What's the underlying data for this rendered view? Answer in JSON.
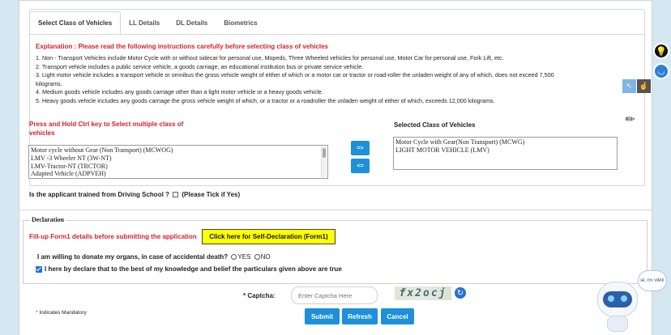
{
  "tabs": [
    {
      "label": "Select Class of Vehicles",
      "active": true
    },
    {
      "label": "LL Details"
    },
    {
      "label": "DL Details"
    },
    {
      "label": "Biometrics"
    }
  ],
  "explanation_title": "Explanation : Please read the following instructions carefully before selecting class of vehicles",
  "instructions": [
    "1. Non - Transport Vehicles include Motor Cycle with or without sidecar for personal use, Mopeds, Three Wheeled vehicles for personal use, Motor Car for personal use, Fork Lift, etc.",
    "2. Transport vehicle includes a public service vehicle, a goods carriage, an educational institution bus or private service vehicle.",
    "3. Light motor vehicle includes a transport vehicle or omnibus the gross vehicle weight of either of which or a motor car or tractor or road-roller the unladen weight of any of which, does not exceed 7,500",
    "kilograms.",
    "4. Medium goods vehicle includes any goods carriage other than a light motor vehicle or a heavy goods vehicle.",
    "5. Heavy goods vehicle includes any goods carriage the gross vehicle weight of which, or a tractor or a roadroller the unladen weight of either of which, exceeds 12,000 kilograms."
  ],
  "press_hold": "Press and Hold Ctrl key to Select multiple class of vehicles",
  "available_classes": [
    "Motor cycle without Gear (Non Transport) (MCWOG)",
    "LMV -3 Wheeler NT (3W-NT)",
    "LMV-Tractor-NT (TRCTOR)",
    "Adapted Vehicle (ADPVEH)"
  ],
  "buttons": {
    "add": "=>",
    "remove": "<=",
    "self_declaration": "Click here for Self-Declaration (Form1)",
    "submit": "Submit",
    "refresh": "Refresh",
    "cancel": "Cancel"
  },
  "selected_title": "Selected Class of Vehicles",
  "selected_classes": [
    "Motor Cycle with Gear(Non Transport) (MCWG)",
    "LIGHT MOTOR VEHICLE (LMV)"
  ],
  "trained_question": "Is the applicant trained from Driving School ?",
  "trained_hint": "(Please Tick if Yes)",
  "declaration": {
    "legend": "Declaration",
    "fillup_text": "Fill-up Form1 details before submitting the application",
    "organ_question": "I am willing to donate my organs, in case of accidental death?",
    "yes": "YES",
    "no": "NO",
    "declare_text": "I here by declare that to the best of my knowledge and belief the particulars given above are true"
  },
  "captcha": {
    "label": "* Captcha:",
    "placeholder": "Enter Captcha Here",
    "code": "fx2ocj"
  },
  "mandatory": {
    "star": "*",
    "text": "Indicates Mandatory"
  },
  "bot_greeting": "Hi, I'm VANI"
}
